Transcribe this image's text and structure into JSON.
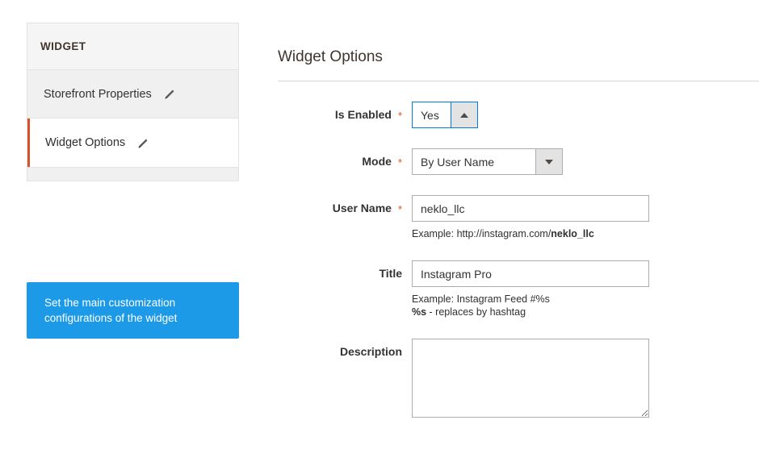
{
  "sidebar": {
    "header_title": "WIDGET",
    "items": [
      {
        "label": "Storefront Properties",
        "icon": "pencil-icon",
        "active": false
      },
      {
        "label": "Widget Options",
        "icon": "pencil-icon",
        "active": true
      }
    ]
  },
  "tooltip": {
    "text": "Set the main customization configurations of the widget",
    "color": "#1c9ae8"
  },
  "main": {
    "heading": "Widget Options",
    "fields": {
      "is_enabled": {
        "label": "Is Enabled",
        "required_marker": "*",
        "value": "Yes",
        "arrow_icon": "chevron-up-icon"
      },
      "mode": {
        "label": "Mode",
        "required_marker": "*",
        "value": "By User Name",
        "arrow_icon": "chevron-down-icon"
      },
      "user_name": {
        "label": "User Name",
        "required_marker": "*",
        "value": "neklo_llc",
        "placeholder": "",
        "hint_prefix": "Example: http://instagram.com/",
        "hint_bold": "neklo_llc"
      },
      "title": {
        "label": "Title",
        "value": "Instagram Pro",
        "placeholder": "",
        "hint_line1": "Example: Instagram Feed #%s",
        "hint_line2_bold": "%s",
        "hint_line2_rest": " - replaces by hashtag"
      },
      "description": {
        "label": "Description",
        "value": "",
        "placeholder": ""
      }
    }
  },
  "colors": {
    "accent_orange": "#d6522c",
    "required_star": "#e04f1a",
    "focus_blue": "#007bdb",
    "tooltip_blue": "#1c9ae8"
  }
}
